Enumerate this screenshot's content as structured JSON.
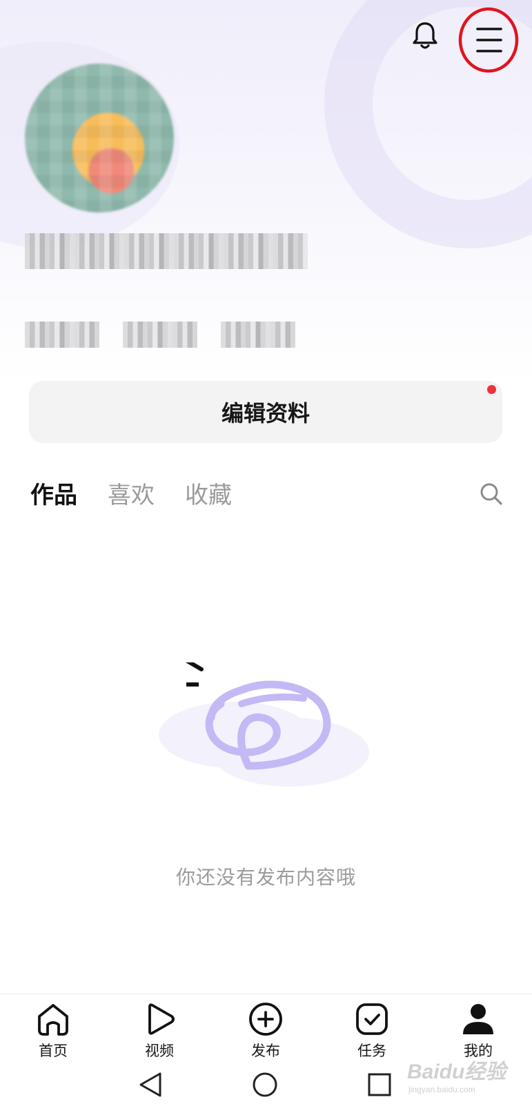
{
  "header": {
    "bell_icon": "bell-icon",
    "menu_icon": "hamburger-menu-icon"
  },
  "profile": {
    "avatar": "avatar",
    "edit_button_label": "编辑资料",
    "edit_badge_color": "#f0303a"
  },
  "tabs": [
    {
      "label": "作品",
      "active": true
    },
    {
      "label": "喜欢",
      "active": false
    },
    {
      "label": "收藏",
      "active": false
    }
  ],
  "empty_state": {
    "message": "你还没有发布内容哦"
  },
  "bottom_nav": [
    {
      "label": "首页",
      "icon": "home-icon"
    },
    {
      "label": "视频",
      "icon": "play-icon"
    },
    {
      "label": "发布",
      "icon": "plus-circle-icon"
    },
    {
      "label": "任务",
      "icon": "check-square-icon"
    },
    {
      "label": "我的",
      "icon": "person-icon"
    }
  ],
  "system_nav": {
    "back_icon": "back-triangle-icon",
    "home_icon": "home-circle-icon",
    "recents_icon": "recents-square-icon"
  },
  "watermark": {
    "main": "Baidu经验",
    "sub": "jingyan.baidu.com"
  },
  "colors": {
    "accent_purple": "#c4b8f5",
    "highlight_circle": "#e0141e"
  }
}
